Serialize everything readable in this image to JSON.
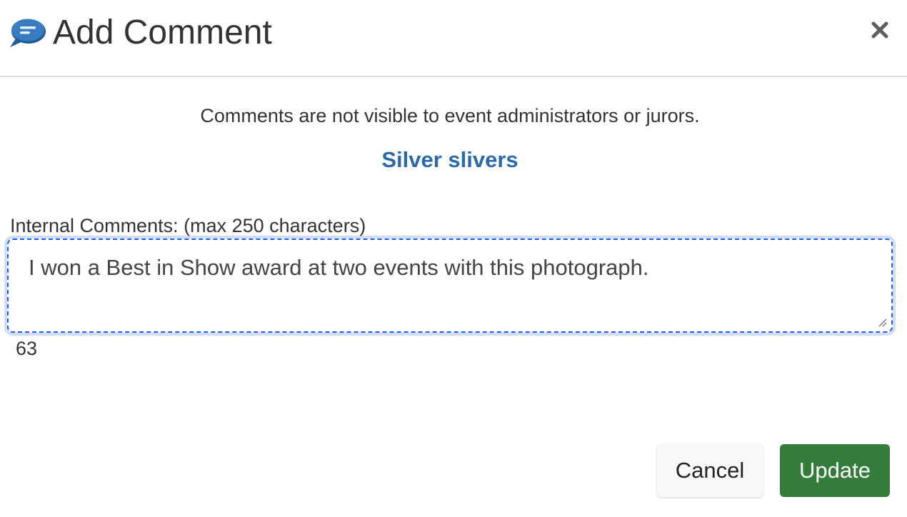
{
  "dialog": {
    "title": "Add Comment",
    "close_icon": "close-icon",
    "header_icon": "speech-bubble-icon",
    "notice": "Comments are not visible to event administrators or jurors.",
    "item_title": "Silver slivers"
  },
  "form": {
    "label": "Internal Comments: (max 250 characters)",
    "comment_value": "I won a Best in Show award at two events with this photograph.",
    "char_count": "63"
  },
  "buttons": {
    "cancel_label": "Cancel",
    "update_label": "Update"
  },
  "colors": {
    "item_title": "#2b6aa8",
    "update_button": "#337c3a",
    "focus_border": "#1a5cff",
    "icon_blue": "#2f6db0"
  }
}
